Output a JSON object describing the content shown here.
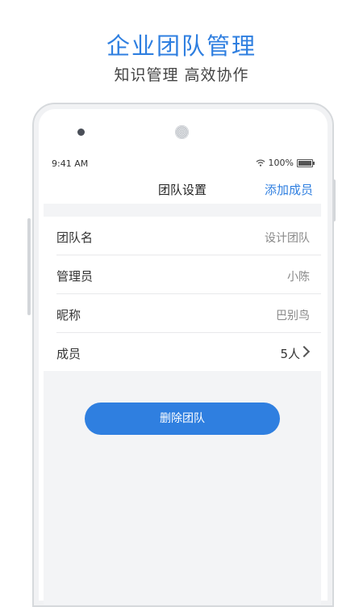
{
  "promo": {
    "title": "企业团队管理",
    "subtitle": "知识管理 高效协作"
  },
  "status_bar": {
    "time": "9:41 AM",
    "battery": "100%",
    "icons": [
      "wifi-icon",
      "battery-icon"
    ]
  },
  "nav": {
    "title": "团队设置",
    "action": "添加成员"
  },
  "settings": [
    {
      "label": "团队名",
      "value": "设计团队"
    },
    {
      "label": "管理员",
      "value": "小陈"
    },
    {
      "label": "昵称",
      "value": "巴别鸟"
    },
    {
      "label": "成员",
      "value": "5人",
      "icon": "chevron-right-icon"
    }
  ],
  "delete_button": "删除团队",
  "colors": {
    "accent": "#2f7fe0",
    "background": "#f3f4f6"
  }
}
